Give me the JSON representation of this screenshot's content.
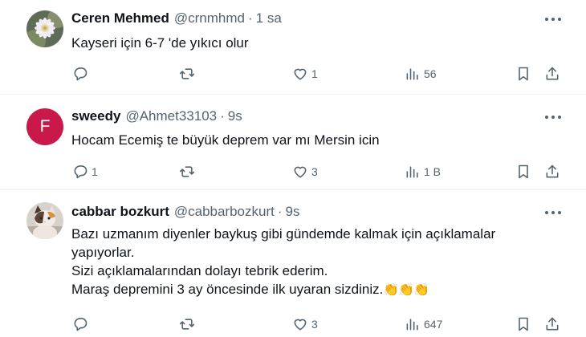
{
  "tweets": [
    {
      "name": "Ceren Mehmed",
      "handle": "@crnmhmd",
      "dot": "·",
      "time": "1 sa",
      "avatar": "cactus-flower-photo",
      "text": "Kayseri için 6-7 'de yıkıcı olur",
      "replies": "",
      "retweets": "",
      "likes": "1",
      "views": "56"
    },
    {
      "name": "sweedy",
      "handle": "@Ahmet33103",
      "dot": "·",
      "time": "9s",
      "avatar_letter": "F",
      "avatar_color": "#c9184a",
      "text": "Hocam Ecemiş te büyük deprem var mı Mersin icin",
      "replies": "1",
      "retweets": "",
      "likes": "3",
      "views": "1 B"
    },
    {
      "name": "cabbar bozkurt",
      "handle": "@cabbarbozkurt",
      "dot": "·",
      "time": "9s",
      "avatar": "cat-photo",
      "lines": [
        "Bazı uzmanım diyenler baykuş gibi gündemde kalmak için açıklamalar yapıyorlar.",
        "Sizi açıklamalarından dolayı tebrik ederim.",
        "Maraş depremini 3 ay öncesinde ilk uyaran sizdiniz."
      ],
      "emoji": "👏👏👏",
      "replies": "",
      "retweets": "",
      "likes": "3",
      "views": "647"
    }
  ],
  "icons": {
    "reply": "reply-icon",
    "retweet": "retweet-icon",
    "like": "heart-icon",
    "views": "views-chart-icon",
    "bookmark": "bookmark-icon",
    "share": "share-icon",
    "more": "more-dots-icon"
  },
  "colors": {
    "text": "#0f1419",
    "secondary": "#536471",
    "divider": "#eff3f4",
    "avatar_f": "#c9184a"
  }
}
